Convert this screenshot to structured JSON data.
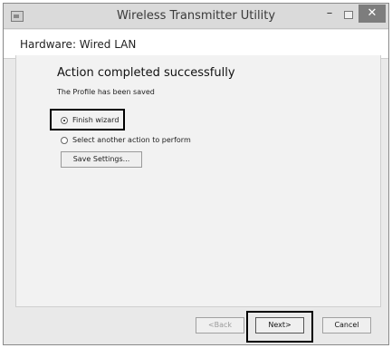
{
  "window": {
    "title": "Wireless Transmitter Utility",
    "minimize_glyph": "–",
    "close_glyph": "✕"
  },
  "header": {
    "title": "Hardware: Wired LAN"
  },
  "main": {
    "title": "Action completed successfully",
    "subtitle": "The Profile has been saved",
    "options": [
      {
        "label": "Finish wizard",
        "selected": true
      },
      {
        "label": "Select another action to perform",
        "selected": false
      }
    ],
    "save_settings_label": "Save Settings..."
  },
  "footer": {
    "back_label": "<Back",
    "next_label": "Next>",
    "cancel_label": "Cancel"
  },
  "icons": {
    "app": "app-icon",
    "minimize": "minimize-icon",
    "maximize": "maximize-icon",
    "close": "close-icon"
  }
}
